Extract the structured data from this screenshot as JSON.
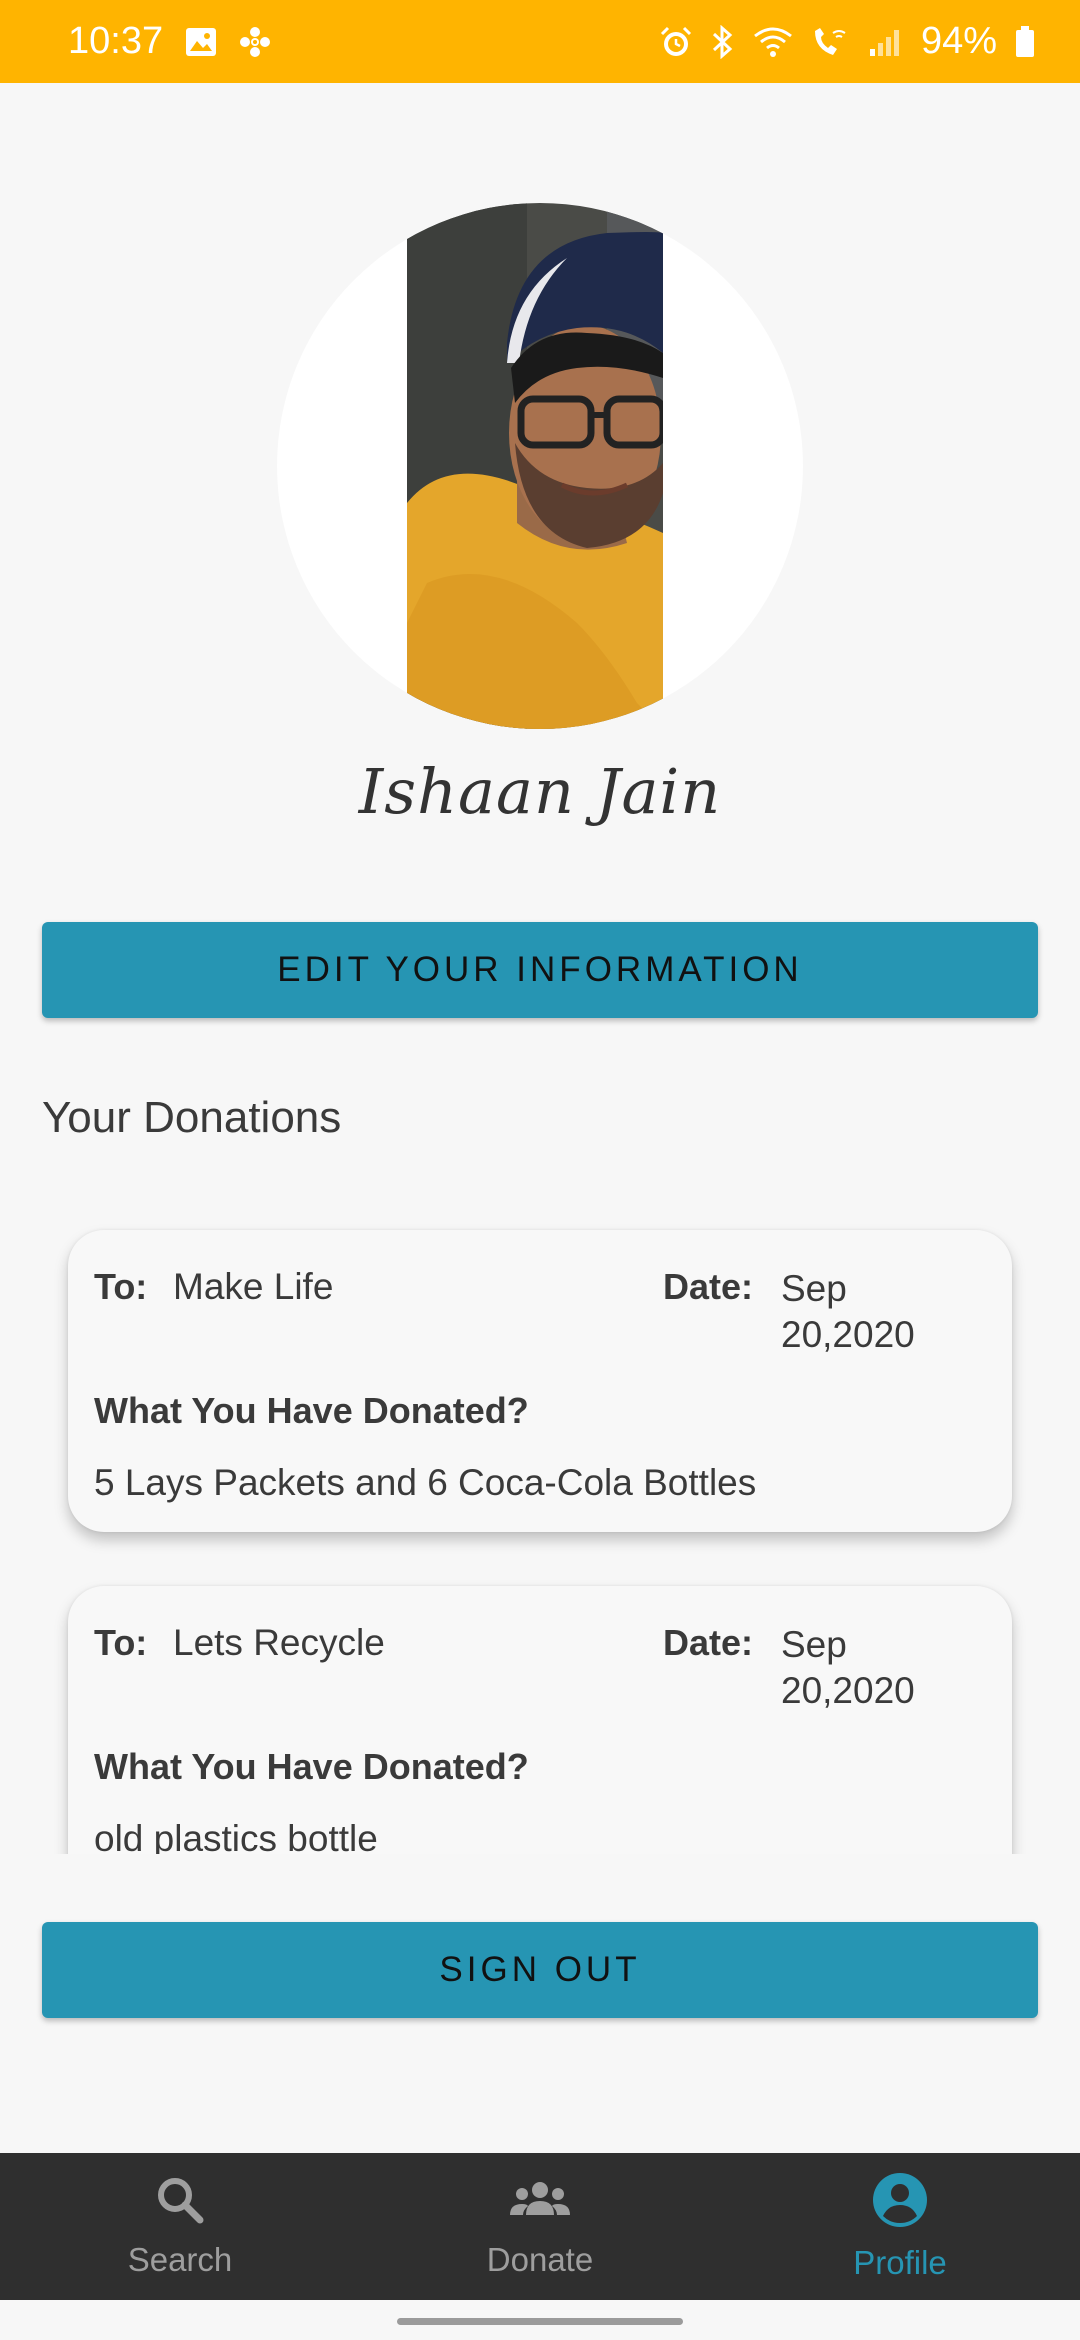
{
  "status_bar": {
    "time": "10:37",
    "battery": "94%",
    "icons": [
      "image-icon",
      "fan-icon",
      "alarm-icon",
      "bluetooth-icon",
      "wifi-icon",
      "wifi-calling-icon",
      "signal-icon",
      "battery-icon"
    ]
  },
  "profile": {
    "name": "Ishaan Jain",
    "edit_button": "EDIT YOUR INFORMATION"
  },
  "donations": {
    "title": "Your Donations",
    "to_label": "To:",
    "date_label": "Date:",
    "question_label": "What You Have Donated?",
    "items": [
      {
        "to": "Make Life",
        "date_line1": "Sep",
        "date_line2": "20,2020",
        "donated": "5 Lays Packets and 6 Coca-Cola Bottles"
      },
      {
        "to": "Lets Recycle",
        "date_line1": "Sep",
        "date_line2": "20,2020",
        "donated": "old plastics bottle"
      }
    ]
  },
  "sign_out_button": "SIGN OUT",
  "nav": {
    "items": [
      {
        "label": "Search",
        "icon": "search-icon",
        "active": false
      },
      {
        "label": "Donate",
        "icon": "people-icon",
        "active": false
      },
      {
        "label": "Profile",
        "icon": "account-circle-icon",
        "active": true
      }
    ]
  },
  "colors": {
    "status_bar": "#ffb400",
    "accent": "#2695b3",
    "nav_bg": "#2f2f2f"
  }
}
